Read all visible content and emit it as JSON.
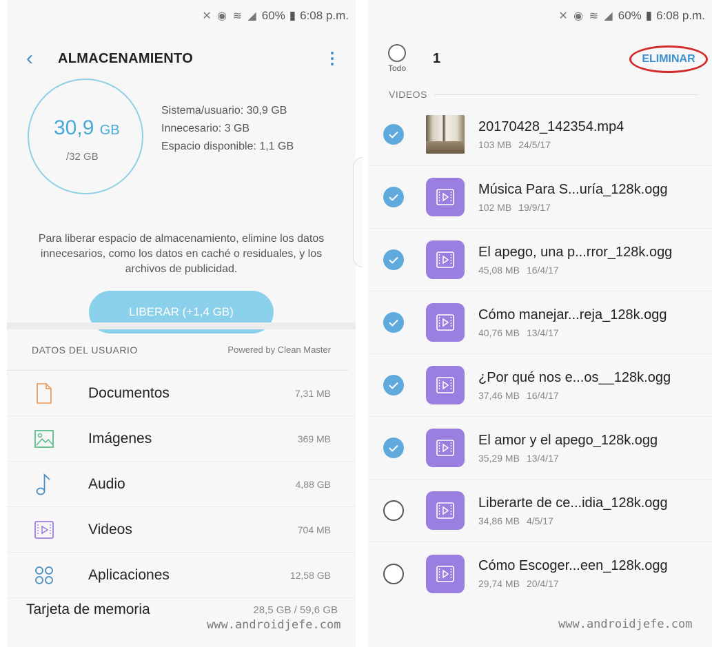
{
  "left": {
    "status": {
      "battery": "60%",
      "time": "6:08 p.m."
    },
    "title": "ALMACENAMIENTO",
    "storage": {
      "used_value": "30,9",
      "used_unit": "GB",
      "total": "/32 GB",
      "stats": [
        "Sistema/usuario: 30,9 GB",
        "Innecesario: 3 GB",
        "Espacio disponible: 1,1 GB"
      ]
    },
    "free_description": "Para liberar espacio de almacenamiento, elimine los datos innecesarios, como los datos en caché o residuales, y los archivos de publicidad.",
    "free_button": "LIBERAR (+1,4 GB)",
    "user_data": {
      "label": "DATOS DEL USUARIO",
      "powered_by": "Powered by Clean Master",
      "categories": [
        {
          "name": "Documentos",
          "size": "7,31 MB",
          "icon": "document-icon",
          "color": "#f0a060"
        },
        {
          "name": "Imágenes",
          "size": "369 MB",
          "icon": "image-icon",
          "color": "#5bbd8a"
        },
        {
          "name": "Audio",
          "size": "4,88 GB",
          "icon": "music-note-icon",
          "color": "#4a90c4"
        },
        {
          "name": "Videos",
          "size": "704 MB",
          "icon": "video-icon",
          "color": "#9a7ee0"
        },
        {
          "name": "Aplicaciones",
          "size": "12,58 GB",
          "icon": "apps-grid-icon",
          "color": "#4a90c4"
        }
      ]
    },
    "memory_card": {
      "name": "Tarjeta de memoria",
      "size": "28,5 GB / 59,6 GB"
    },
    "watermark": "www.androidjefe.com"
  },
  "right": {
    "status": {
      "battery": "60%",
      "time": "6:08 p.m."
    },
    "select_all_label": "Todo",
    "selected_count": "1",
    "delete_button": "ELIMINAR",
    "section_label": "VIDEOS",
    "files": [
      {
        "name": "20170428_142354.mp4",
        "size": "103 MB",
        "date": "24/5/17",
        "checked": true,
        "thumb": "photo"
      },
      {
        "name": "Música Para S...uría_128k.ogg",
        "size": "102 MB",
        "date": "19/9/17",
        "checked": true,
        "thumb": "video"
      },
      {
        "name": "El apego, una p...rror_128k.ogg",
        "size": "45,08 MB",
        "date": "16/4/17",
        "checked": true,
        "thumb": "video"
      },
      {
        "name": "Cómo manejar...reja_128k.ogg",
        "size": "40,76 MB",
        "date": "13/4/17",
        "checked": true,
        "thumb": "video"
      },
      {
        "name": "¿Por qué nos e...os__128k.ogg",
        "size": "37,46 MB",
        "date": "16/4/17",
        "checked": true,
        "thumb": "video"
      },
      {
        "name": "El amor y el apego_128k.ogg",
        "size": "35,29 MB",
        "date": "13/4/17",
        "checked": true,
        "thumb": "video"
      },
      {
        "name": "Liberarte de ce...idia_128k.ogg",
        "size": "34,86 MB",
        "date": "4/5/17",
        "checked": false,
        "thumb": "video"
      },
      {
        "name": "Cómo Escoger...een_128k.ogg",
        "size": "29,74 MB",
        "date": "20/4/17",
        "checked": false,
        "thumb": "video"
      }
    ],
    "watermark": "www.androidjefe.com"
  }
}
